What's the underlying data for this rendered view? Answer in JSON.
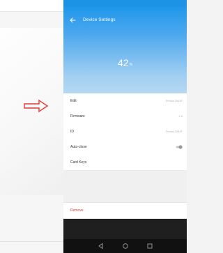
{
  "header": {
    "title": "Device Settings",
    "battery_value": "42",
    "battery_unit": "%"
  },
  "settings": [
    {
      "label": "Edit",
      "value": "Fenda-2041F"
    },
    {
      "label": "Firmware",
      "value": "1.0"
    },
    {
      "label": "ID",
      "value": "Fenda-2041F"
    },
    {
      "label": "Auto-close",
      "value": ""
    },
    {
      "label": "Card Keys",
      "value": ""
    }
  ],
  "remove_label": "Remove",
  "colors": {
    "header_top": "#2097ea",
    "header_bottom": "#b6d8f2",
    "arrow": "#e53935",
    "remove": "#d33c3c"
  }
}
